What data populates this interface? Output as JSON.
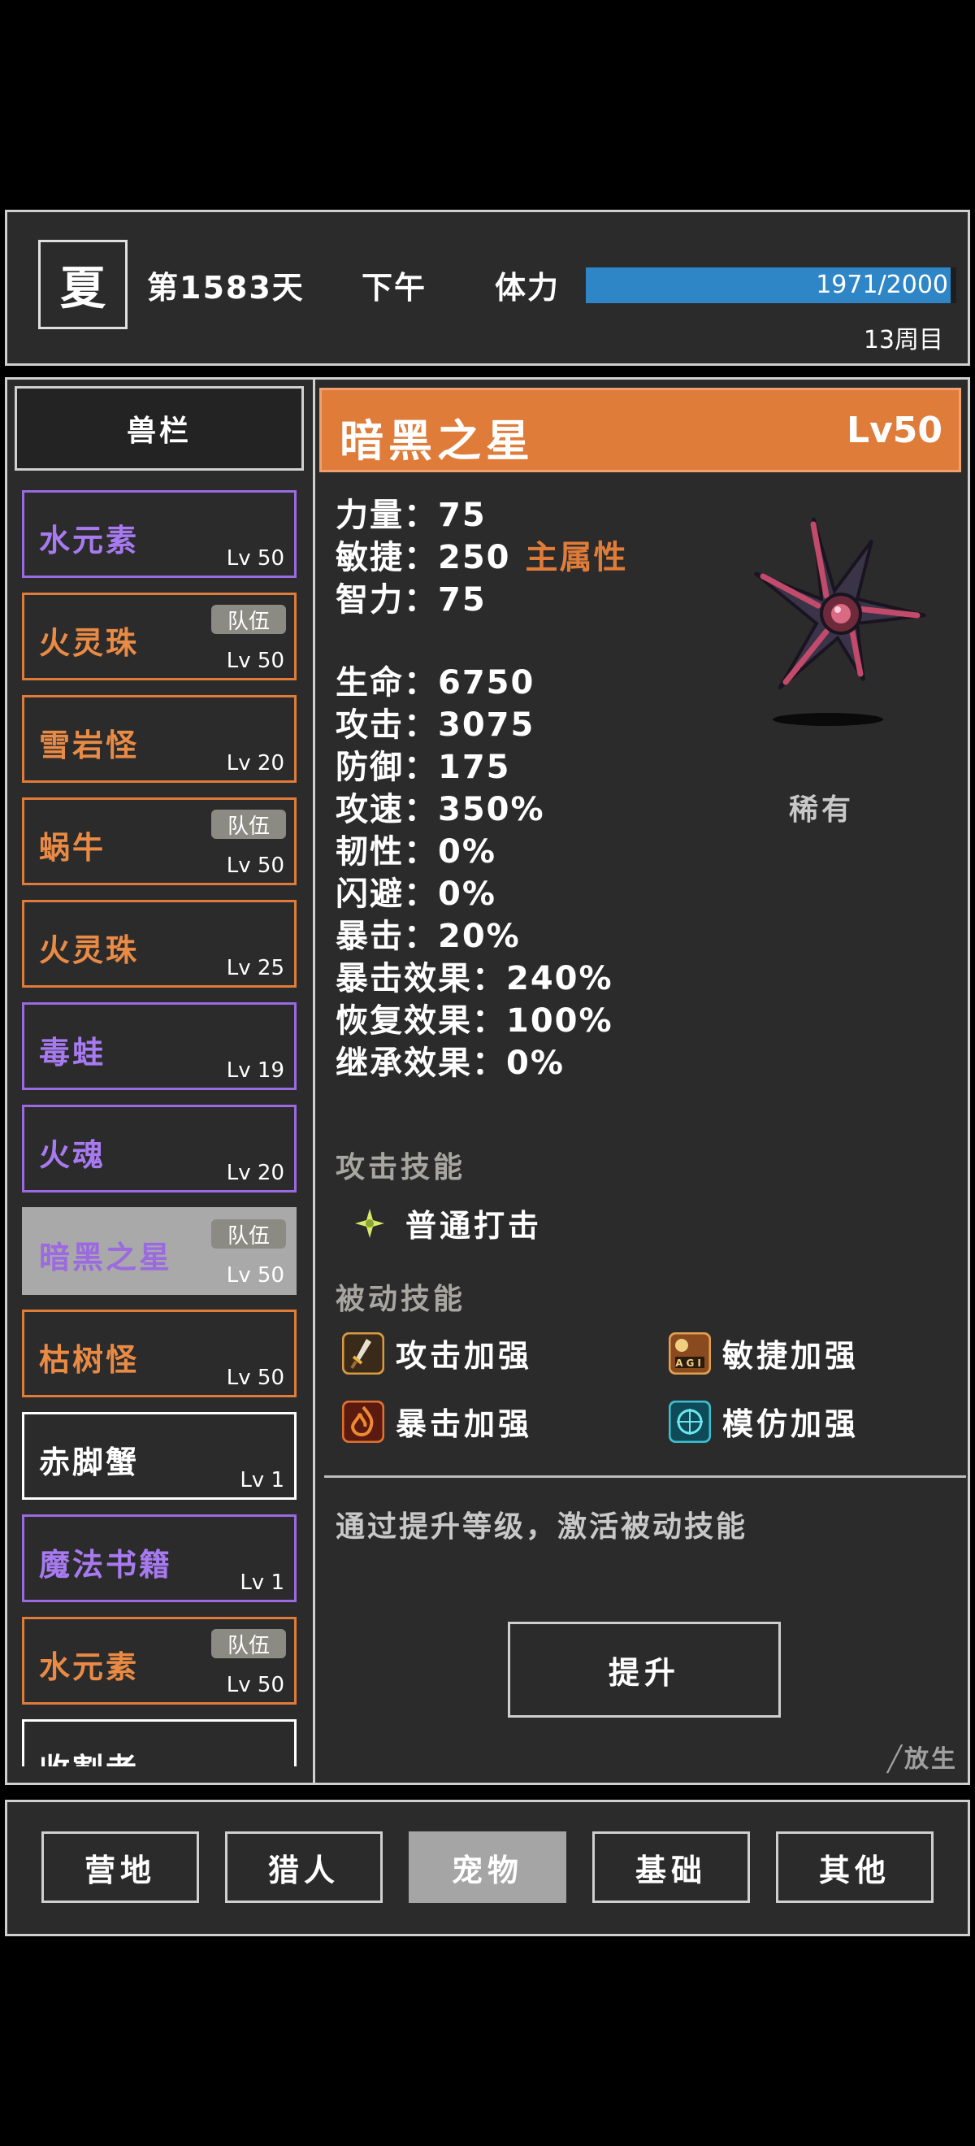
{
  "topbar": {
    "season": "夏",
    "day": "第1583天",
    "time_of_day": "下午",
    "stamina_label": "体力",
    "stamina_value": "1971/2000",
    "stamina_fraction": 0.9855,
    "cycle": "13周目"
  },
  "pet_list": {
    "header": "兽栏",
    "items": [
      {
        "name": "水元素",
        "level": "Lv 50",
        "team": "",
        "color": "#9b6ae0",
        "name_color": "#a77af0",
        "selected": false
      },
      {
        "name": "火灵珠",
        "level": "Lv 50",
        "team": "队伍",
        "color": "#e07c3a",
        "name_color": "#e98a45",
        "selected": false
      },
      {
        "name": "雪岩怪",
        "level": "Lv 20",
        "team": "",
        "color": "#e07c3a",
        "name_color": "#e98a45",
        "selected": false
      },
      {
        "name": "蜗牛",
        "level": "Lv 50",
        "team": "队伍",
        "color": "#e07c3a",
        "name_color": "#e98a45",
        "selected": false
      },
      {
        "name": "火灵珠",
        "level": "Lv 25",
        "team": "",
        "color": "#e07c3a",
        "name_color": "#e98a45",
        "selected": false
      },
      {
        "name": "毒蛙",
        "level": "Lv 19",
        "team": "",
        "color": "#9b6ae0",
        "name_color": "#a77af0",
        "selected": false
      },
      {
        "name": "火魂",
        "level": "Lv 20",
        "team": "",
        "color": "#9b6ae0",
        "name_color": "#a77af0",
        "selected": false
      },
      {
        "name": "暗黑之星",
        "level": "Lv 50",
        "team": "队伍",
        "color": "#a9a9a9",
        "name_color": "#9b6ae0",
        "selected": true
      },
      {
        "name": "枯树怪",
        "level": "Lv 50",
        "team": "",
        "color": "#e07c3a",
        "name_color": "#e98a45",
        "selected": false
      },
      {
        "name": "赤脚蟹",
        "level": "Lv 1",
        "team": "",
        "color": "#ffffff",
        "name_color": "#ffffff",
        "selected": false
      },
      {
        "name": "魔法书籍",
        "level": "Lv 1",
        "team": "",
        "color": "#9b6ae0",
        "name_color": "#a77af0",
        "selected": false
      },
      {
        "name": "水元素",
        "level": "Lv 50",
        "team": "队伍",
        "color": "#e07c3a",
        "name_color": "#e98a45",
        "selected": false
      },
      {
        "name": "收割者",
        "level": "",
        "team": "",
        "color": "#ffffff",
        "name_color": "#ffffff",
        "selected": false
      }
    ]
  },
  "detail": {
    "name": "暗黑之星",
    "level": "Lv50",
    "rarity": "稀有",
    "strength": "力量：75",
    "agility": "敏捷：250",
    "main_attr": "主属性",
    "intellect": "智力：75",
    "hp": "生命：6750",
    "attack": "攻击：3075",
    "defense": "防御：175",
    "attack_speed": "攻速：350%",
    "toughness": "韧性：0%",
    "dodge": "闪避：0%",
    "crit": "暴击：20%",
    "crit_effect": "暴击效果：240%",
    "recovery_effect": "恢复效果：100%",
    "inherit_effect": "继承效果：0%",
    "attack_skills_title": "攻击技能",
    "attack_skill": "普通打击",
    "passive_skills_title": "被动技能",
    "passive_skills": [
      "攻击加强",
      "敏捷加强",
      "暴击加强",
      "模仿加强"
    ],
    "hint": "通过提升等级，激活被动技能",
    "upgrade": "提升",
    "release": "╱放生"
  },
  "nav": [
    "营地",
    "猎人",
    "宠物",
    "基础",
    "其他"
  ],
  "nav_active": "宠物"
}
